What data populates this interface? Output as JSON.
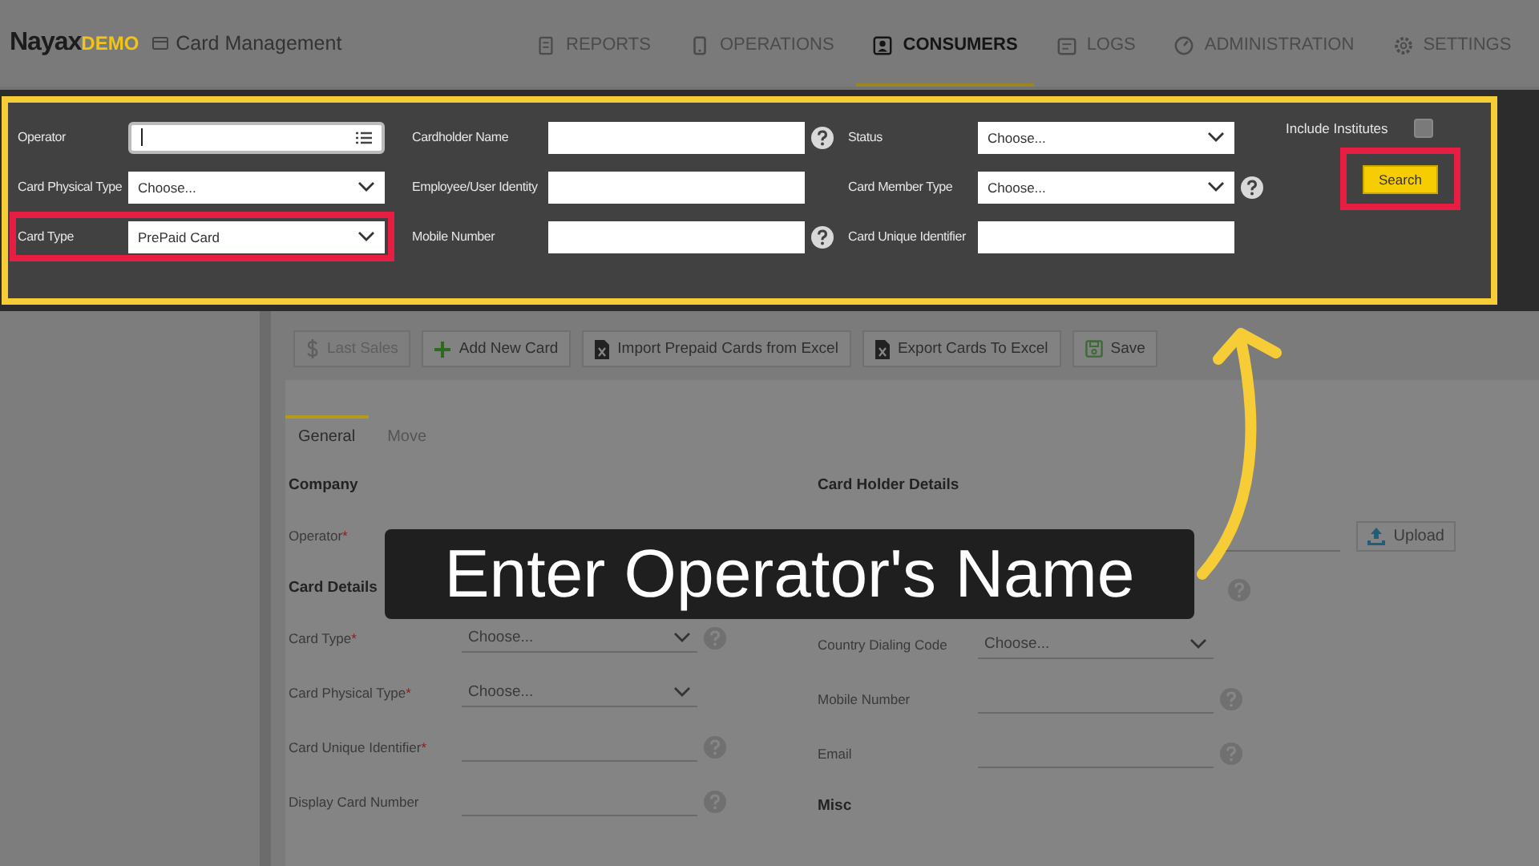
{
  "header": {
    "logo": "Nayax",
    "logo_badge": "DEMO",
    "app_title": "Card Management",
    "nav": [
      {
        "label": "REPORTS",
        "selected": false
      },
      {
        "label": "OPERATIONS",
        "selected": false
      },
      {
        "label": "CONSUMERS",
        "selected": true
      },
      {
        "label": "LOGS",
        "selected": false
      },
      {
        "label": "ADMINISTRATION",
        "selected": false
      },
      {
        "label": "SETTINGS",
        "selected": false
      }
    ]
  },
  "filters": {
    "fields": [
      {
        "label": "Operator",
        "kind": "lookup",
        "help": false,
        "highlighted": false
      },
      {
        "label": "Cardholder Name",
        "kind": "text",
        "help": true,
        "highlighted": false
      },
      {
        "label": "Status",
        "kind": "select",
        "value": "Choose...",
        "help": false,
        "highlighted": false
      },
      {
        "label": "Card Physical Type",
        "kind": "select",
        "value": "Choose...",
        "help": false,
        "highlighted": false
      },
      {
        "label": "Employee/User Identity",
        "kind": "text",
        "help": false,
        "highlighted": false
      },
      {
        "label": "Card Member Type",
        "kind": "select",
        "value": "Choose...",
        "help": true,
        "highlighted": false
      },
      {
        "label": "Card Type",
        "kind": "select",
        "value": "PrePaid Card",
        "help": false,
        "highlighted": true
      },
      {
        "label": "Mobile Number",
        "kind": "text",
        "help": true,
        "highlighted": false
      },
      {
        "label": "Card Unique Identifier",
        "kind": "text",
        "help": false,
        "highlighted": false
      }
    ],
    "include_institutes": {
      "label": "Include Institutes",
      "checked": false
    },
    "search_button": {
      "label": "Search",
      "highlighted": true
    }
  },
  "toolbar": [
    {
      "label": "Last Sales",
      "disabled": true
    },
    {
      "label": "Add New Card",
      "disabled": false
    },
    {
      "label": "Import Prepaid Cards from Excel",
      "disabled": false
    },
    {
      "label": "Export Cards To Excel",
      "disabled": false
    },
    {
      "label": "Save",
      "disabled": false
    }
  ],
  "tabs": [
    {
      "label": "General",
      "selected": true
    },
    {
      "label": "Move",
      "selected": false
    }
  ],
  "form": {
    "left": [
      {
        "kind": "heading",
        "label": "Company"
      },
      {
        "kind": "label",
        "label": "Operator",
        "required_mark": "*"
      },
      {
        "kind": "heading",
        "label": "Card Details"
      },
      {
        "kind": "select",
        "label": "Card Type",
        "required_mark": "*",
        "value": "Choose...",
        "help": true
      },
      {
        "kind": "select",
        "label": "Card Physical Type",
        "required_mark": "*",
        "value": "Choose...",
        "help": false
      },
      {
        "kind": "text",
        "label": "Card Unique Identifier",
        "required_mark": "*",
        "help": true
      },
      {
        "kind": "text",
        "label": "Display Card Number",
        "help": true
      }
    ],
    "right": [
      {
        "kind": "heading",
        "label": "Card Holder Details"
      },
      {
        "kind": "upload",
        "label": "Upload"
      },
      {
        "kind": "covered",
        "help": true
      },
      {
        "kind": "select",
        "label": "Country Dialing Code",
        "value": "Choose...",
        "help": false
      },
      {
        "kind": "text",
        "label": "Mobile Number",
        "help": true
      },
      {
        "kind": "text",
        "label": "Email",
        "help": true
      },
      {
        "kind": "heading",
        "label": "Misc"
      }
    ]
  },
  "caption": "Enter Operator's Name"
}
